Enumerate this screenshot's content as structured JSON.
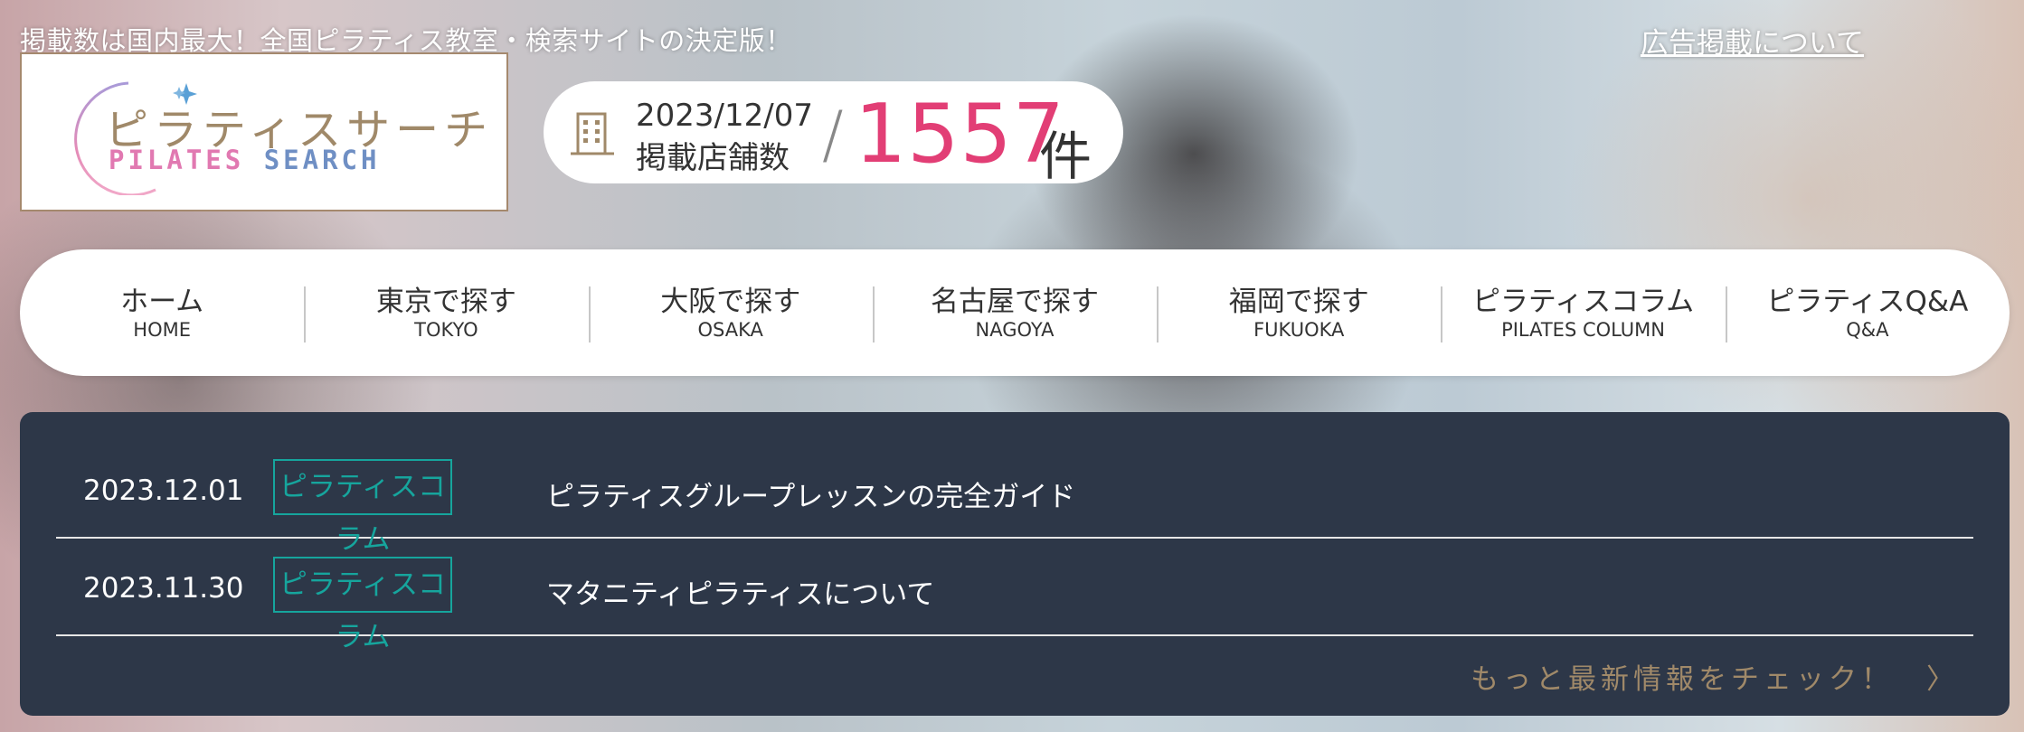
{
  "header": {
    "tagline": "掲載数は国内最大！全国ピラティス教室・検索サイトの決定版！",
    "ad_link": "広告掲載について"
  },
  "logo": {
    "jp": "ピラティスサーチ",
    "en_pink": "PILATES",
    "en_blue": "SEARCH"
  },
  "counter": {
    "date": "2023/12/07",
    "label": "掲載店舗数",
    "slash": "/",
    "count": "1557",
    "unit": "件",
    "icon": "building-icon"
  },
  "nav": {
    "items": [
      {
        "ja": "ホーム",
        "en": "HOME"
      },
      {
        "ja": "東京で探す",
        "en": "TOKYO"
      },
      {
        "ja": "大阪で探す",
        "en": "OSAKA"
      },
      {
        "ja": "名古屋で探す",
        "en": "NAGOYA"
      },
      {
        "ja": "福岡で探す",
        "en": "FUKUOKA"
      },
      {
        "ja": "ピラティスコラム",
        "en": "PILATES COLUMN"
      },
      {
        "ja": "ピラティスQ&A",
        "en": "Q&A"
      }
    ]
  },
  "news": {
    "items": [
      {
        "date": "2023.12.01",
        "tag": "ピラティスコラム",
        "title": "ピラティスグループレッスンの完全ガイド"
      },
      {
        "date": "2023.11.30",
        "tag": "ピラティスコラム",
        "title": "マタニティピラティスについて"
      }
    ],
    "more": "もっと最新情報をチェック！　〉"
  },
  "colors": {
    "accent_pink": "#e23e75",
    "tag_teal": "#16a59d",
    "news_bg": "#2d3748",
    "gold": "#a08969"
  }
}
